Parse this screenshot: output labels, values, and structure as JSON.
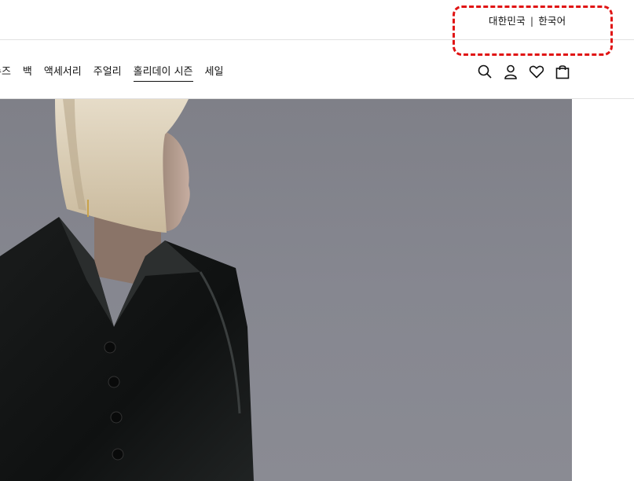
{
  "header": {
    "country": "대한민국",
    "separator": "|",
    "language": "한국어"
  },
  "nav": {
    "items": [
      {
        "label": "슈즈",
        "active": false
      },
      {
        "label": "백",
        "active": false
      },
      {
        "label": "액세서리",
        "active": false
      },
      {
        "label": "주얼리",
        "active": false
      },
      {
        "label": "홀리데이 시즌",
        "active": true
      },
      {
        "label": "세일",
        "active": false
      }
    ]
  },
  "icons": [
    "search-icon",
    "account-icon",
    "wishlist-icon",
    "shopping-bag-icon"
  ],
  "colors": {
    "highlight": "#e01414",
    "hero_background": "#868790",
    "text": "#111111"
  }
}
